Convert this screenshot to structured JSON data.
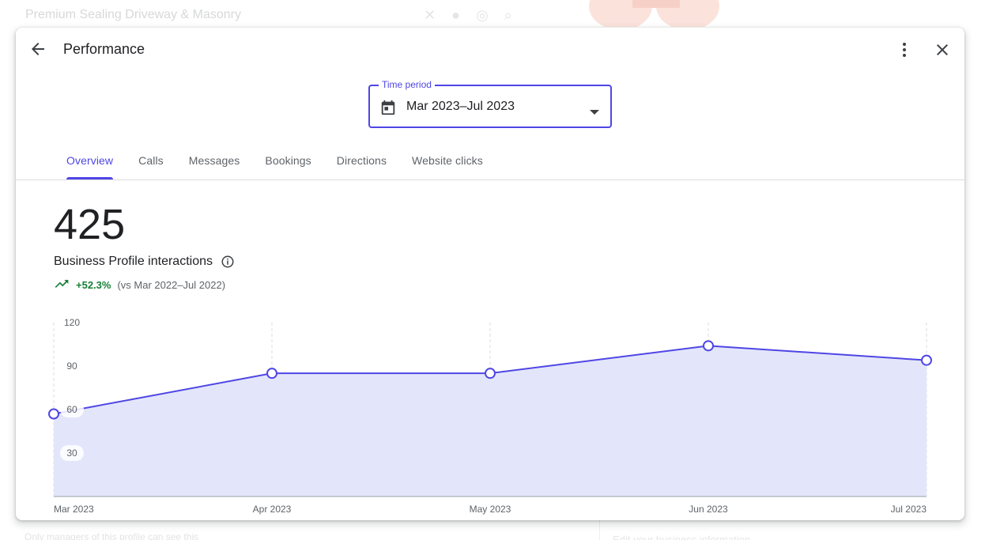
{
  "background": {
    "search_text": "Premium Sealing Driveway & Masonry",
    "bottom_left_text": "Only managers of this profile can see this",
    "bottom_right_text": "Edit your business information"
  },
  "dialog": {
    "title": "Performance",
    "back_icon": "arrow-back-icon",
    "more_icon": "more-vert-icon",
    "close_icon": "close-icon"
  },
  "time_period": {
    "label": "Time period",
    "value": "Mar 2023–Jul 2023",
    "icon": "calendar-icon"
  },
  "tabs": [
    {
      "label": "Overview",
      "active": true
    },
    {
      "label": "Calls",
      "active": false
    },
    {
      "label": "Messages",
      "active": false
    },
    {
      "label": "Bookings",
      "active": false
    },
    {
      "label": "Directions",
      "active": false
    },
    {
      "label": "Website clicks",
      "active": false
    }
  ],
  "metric": {
    "value": "425",
    "label": "Business Profile interactions",
    "change": "+52.3%",
    "comparison": "(vs Mar 2022–Jul 2022)"
  },
  "colors": {
    "accent": "#4f46e5",
    "area_fill": "#e3e6fa",
    "positive": "#188038"
  },
  "chart_data": {
    "type": "area",
    "categories": [
      "Mar 2023",
      "Apr 2023",
      "May 2023",
      "Jun 2023",
      "Jul 2023"
    ],
    "values": [
      57,
      85,
      85,
      104,
      94
    ],
    "yticks": [
      "30",
      "60",
      "90",
      "120"
    ],
    "ylim": [
      0,
      120
    ],
    "grid": "vertical dashed"
  }
}
